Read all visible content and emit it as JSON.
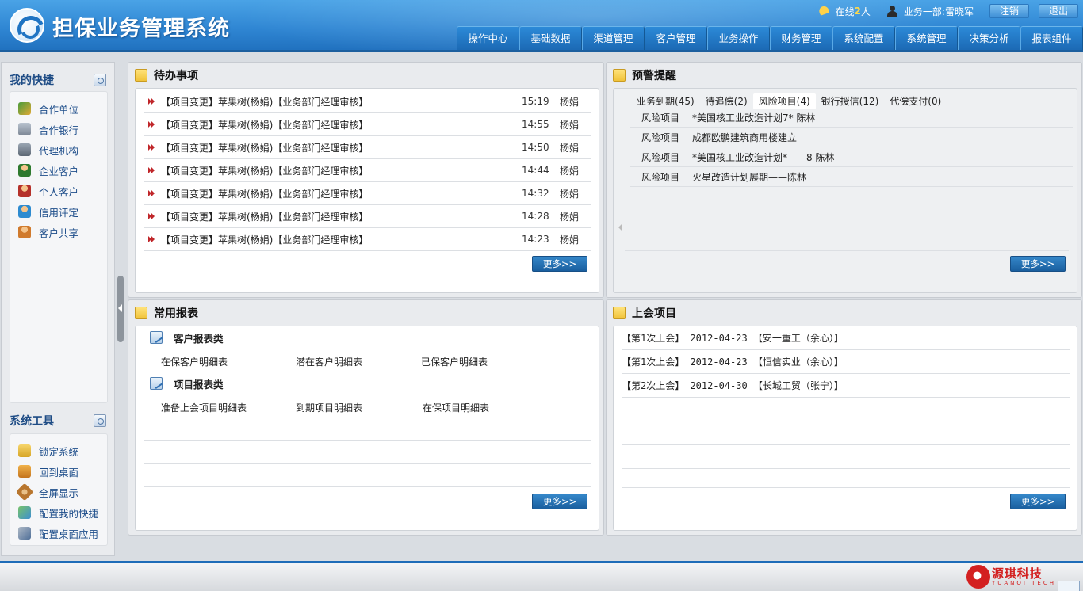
{
  "header": {
    "title": "担保业务管理系统",
    "online_prefix": "在线",
    "online_count": "2",
    "online_suffix": "人",
    "user": "业务一部:雷晓军",
    "logout_label": "注销",
    "exit_label": "退出"
  },
  "menu": [
    "操作中心",
    "基础数据",
    "渠道管理",
    "客户管理",
    "业务操作",
    "财务管理",
    "系统配置",
    "系统管理",
    "决策分析",
    "报表组件"
  ],
  "sidebar": {
    "shortcuts_title": "我的快捷",
    "shortcuts": [
      {
        "label": "合作单位",
        "icon": "handshake-icon"
      },
      {
        "label": "合作银行",
        "icon": "bank-icon"
      },
      {
        "label": "代理机构",
        "icon": "building-icon"
      },
      {
        "label": "企业客户",
        "icon": "company-user-icon"
      },
      {
        "label": "个人客户",
        "icon": "person-user-icon"
      },
      {
        "label": "信用评定",
        "icon": "credit-user-icon"
      },
      {
        "label": "客户共享",
        "icon": "share-user-icon"
      }
    ],
    "tools_title": "系统工具",
    "tools": [
      {
        "label": "锁定系统",
        "icon": "lock-icon"
      },
      {
        "label": "回到桌面",
        "icon": "desktop-icon"
      },
      {
        "label": "全屏显示",
        "icon": "fullscreen-icon"
      },
      {
        "label": "配置我的快捷",
        "icon": "config-shortcut-icon"
      },
      {
        "label": "配置桌面应用",
        "icon": "config-app-icon"
      }
    ]
  },
  "todo": {
    "title": "待办事项",
    "more_label": "更多>>",
    "items": [
      {
        "text": "【项目变更】苹果树(杨娟)【业务部门经理审核】",
        "time": "15:19",
        "who": "杨娟"
      },
      {
        "text": "【项目变更】苹果树(杨娟)【业务部门经理审核】",
        "time": "14:55",
        "who": "杨娟"
      },
      {
        "text": "【项目变更】苹果树(杨娟)【业务部门经理审核】",
        "time": "14:50",
        "who": "杨娟"
      },
      {
        "text": "【项目变更】苹果树(杨娟)【业务部门经理审核】",
        "time": "14:44",
        "who": "杨娟"
      },
      {
        "text": "【项目变更】苹果树(杨娟)【业务部门经理审核】",
        "time": "14:32",
        "who": "杨娟"
      },
      {
        "text": "【项目变更】苹果树(杨娟)【业务部门经理审核】",
        "time": "14:28",
        "who": "杨娟"
      },
      {
        "text": "【项目变更】苹果树(杨娟)【业务部门经理审核】",
        "time": "14:23",
        "who": "杨娟"
      }
    ]
  },
  "warning": {
    "title": "预警提醒",
    "more_label": "更多>>",
    "tabs": [
      "业务到期(45)",
      "待追偿(2)",
      "风险项目(4)",
      "银行授信(12)",
      "代偿支付(0)"
    ],
    "active_tab": "风险项目(4)",
    "items": [
      {
        "type": "风险项目",
        "desc": "*美国核工业改造计划7* 陈林"
      },
      {
        "type": "风险项目",
        "desc": "成都欧鹏建筑商用楼建立"
      },
      {
        "type": "风险项目",
        "desc": "*美国核工业改造计划*——8  陈林"
      },
      {
        "type": "风险项目",
        "desc": "火星改造计划展期——陈林"
      }
    ]
  },
  "reports": {
    "title": "常用报表",
    "more_label": "更多>>",
    "groups": [
      {
        "name": "客户报表类",
        "links": [
          "在保客户明细表",
          "潜在客户明细表",
          "已保客户明细表"
        ]
      },
      {
        "name": "项目报表类",
        "links": [
          "准备上会项目明细表",
          "到期项目明细表",
          "在保项目明细表"
        ]
      }
    ]
  },
  "meetings": {
    "title": "上会项目",
    "more_label": "更多>>",
    "items": [
      "【第1次上会】 2012-04-23 【安一重工（余心）】",
      "【第1次上会】 2012-04-23 【恒信实业（余心）】",
      "【第2次上会】 2012-04-30 【长城工贸（张宁）】"
    ]
  },
  "footer": {
    "brand_name": "源琪科技",
    "brand_sub": "YUANQI TECH"
  }
}
